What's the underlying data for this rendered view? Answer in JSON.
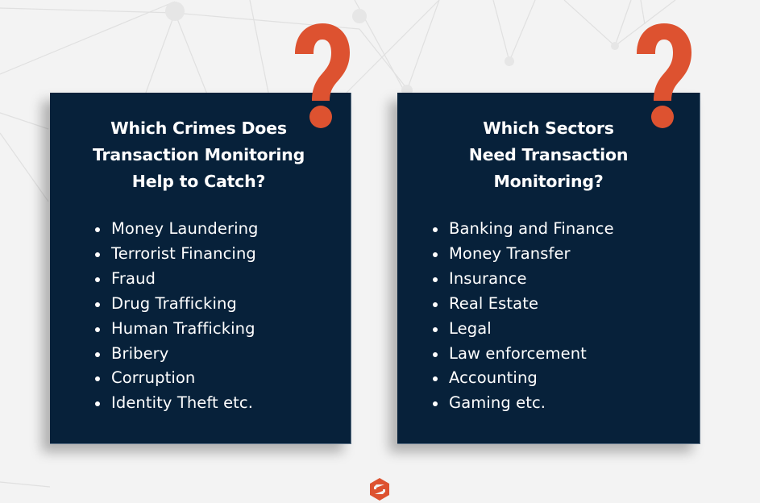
{
  "colors": {
    "background": "#f3f3f3",
    "card": "#07213a",
    "accent": "#dd5230",
    "text": "#ffffff",
    "network_lines": "#dedede"
  },
  "cards": [
    {
      "title_lines": [
        "Which Crimes Does",
        "Transaction Monitoring",
        "Help to Catch?"
      ],
      "items": [
        "Money Laundering",
        "Terrorist Financing",
        "Fraud",
        "Drug Trafficking",
        "Human Trafficking",
        "Bribery",
        "Corruption",
        "Identity Theft etc."
      ],
      "icon": "question-mark-icon"
    },
    {
      "title_lines": [
        "Which Sectors",
        "Need Transaction",
        "Monitoring?"
      ],
      "items": [
        "Banking and Finance",
        "Money Transfer",
        "Insurance",
        "Real Estate",
        "Legal",
        "Law enforcement",
        "Accounting",
        "Gaming etc."
      ],
      "icon": "question-mark-icon"
    }
  ],
  "footer": {
    "logo_icon": "brand-s-hexagon-icon"
  }
}
